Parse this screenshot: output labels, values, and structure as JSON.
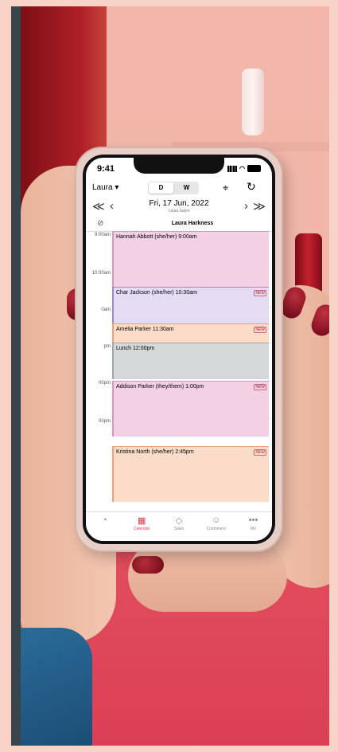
{
  "status": {
    "time": "9:41"
  },
  "toolbar": {
    "staff_label": "Laura ▾",
    "view_day": "D",
    "view_week": "W",
    "location_icon": "location-pin-icon",
    "refresh_icon": "refresh-icon"
  },
  "datebar": {
    "date": "Fri, 17 Jun, 2022",
    "location": "Laura Salon",
    "prev_week": "≪",
    "prev_day": "‹",
    "next_day": "›",
    "next_week": "≫"
  },
  "column": {
    "staff_name": "Laura Harkness"
  },
  "times": [
    "9:00am",
    "10:00am",
    "0am",
    "pm",
    "00pm",
    "00pm"
  ],
  "appointments": [
    {
      "title": "Hannah Abbott (she/her) 9:00am",
      "color": "#f4d0e4",
      "border": "#e38fbf"
    },
    {
      "title": "Char Jackson (she/her) 10:30am",
      "color": "#e5dcf4",
      "border": "#9f86d8",
      "badge": "NEW"
    },
    {
      "title": "Amelia Parker 11:30am",
      "color": "#fbdcc8",
      "border": "#f0a17a",
      "badge": "NEW"
    },
    {
      "title": "Lunch 12:00pm",
      "color": "#d5d8d8",
      "border": "#a0a7a7"
    },
    {
      "title": "Addison Parker (they/them) 1:00pm",
      "color": "#f4d0e4",
      "border": "#e38fbf",
      "badge": "NEW"
    },
    {
      "title": "Kristina North (she/her) 2:45pm",
      "color": "#fbdcc8",
      "border": "#f0a17a",
      "badge": "NEW"
    }
  ],
  "tabs": [
    {
      "label": "",
      "icon": "bell-icon"
    },
    {
      "label": "Calendar",
      "icon": "calendar-icon"
    },
    {
      "label": "Sales",
      "icon": "tag-icon"
    },
    {
      "label": "Customers",
      "icon": "customers-icon"
    },
    {
      "label": "Mo",
      "icon": "more-icon"
    }
  ]
}
